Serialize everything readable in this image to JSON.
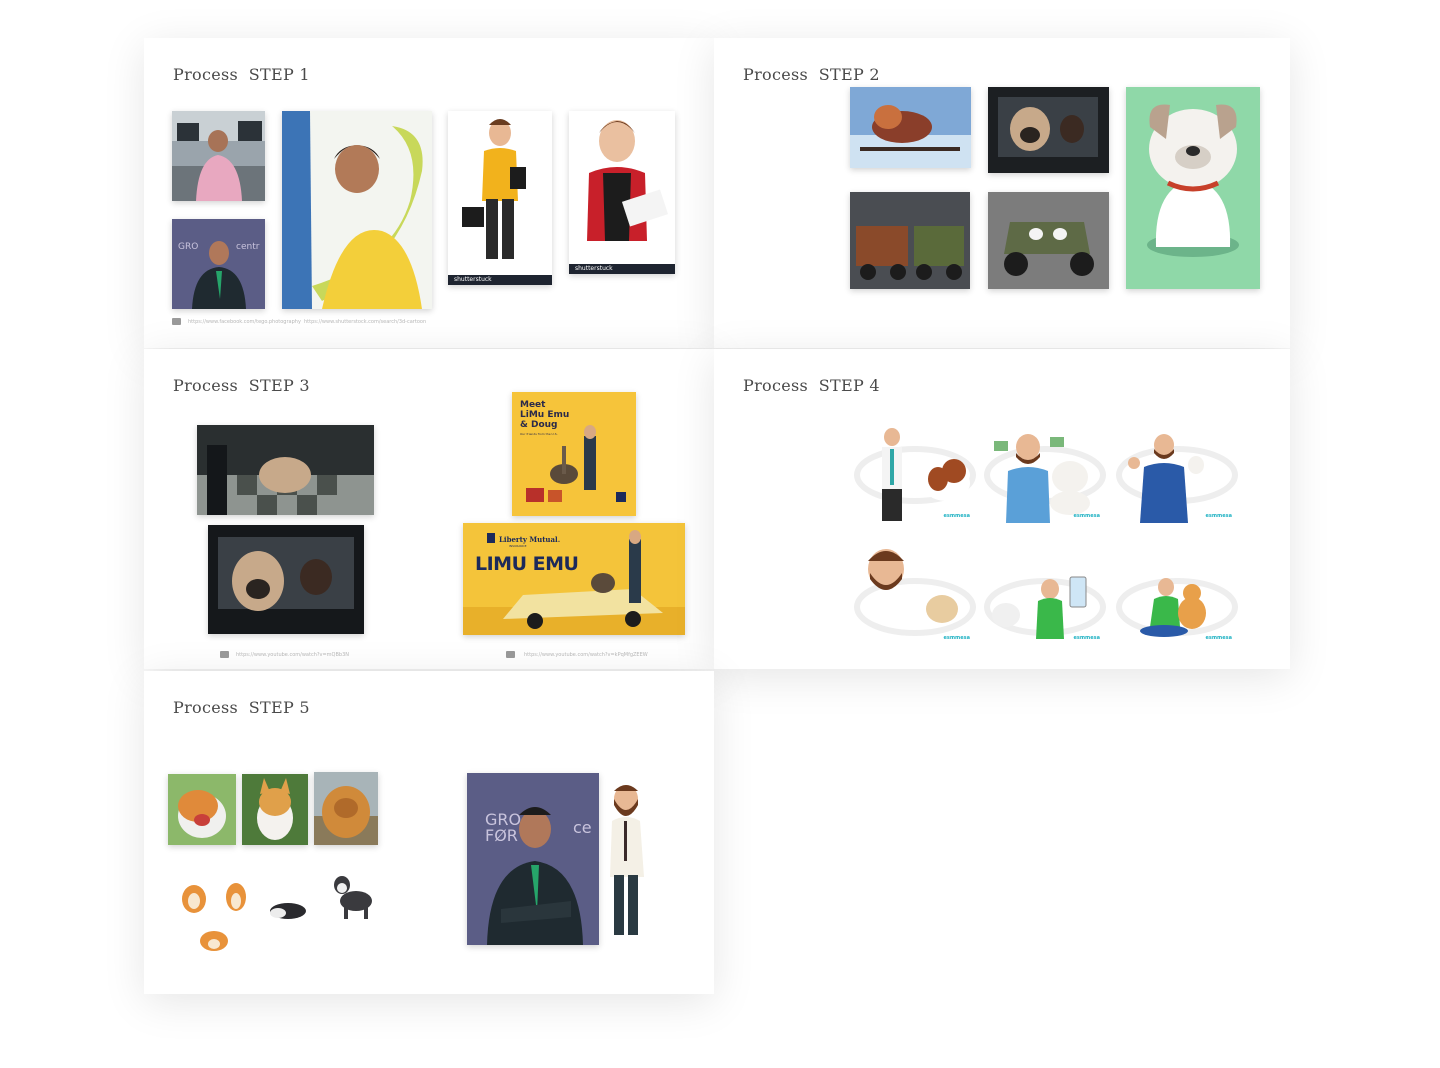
{
  "steps": [
    {
      "title": "Process  STEP 1"
    },
    {
      "title": "Process  STEP 2"
    },
    {
      "title": "Process  STEP 3"
    },
    {
      "title": "Process  STEP 4"
    },
    {
      "title": "Process  STEP 5"
    }
  ],
  "step1": {
    "stamp_1": "shutterstuck",
    "stamp_2": "shutterstuck",
    "source_1": "https://www.facebook.com/tego.photography",
    "source_2": "https://www.shutterstock.com/search/3d-cartoon"
  },
  "step3": {
    "poster1_line1": "Meet",
    "poster1_line2": "LiMu Emu",
    "poster1_line3": "& Doug",
    "poster1_small": "Our friends from the U.S.",
    "poster2_brand": "Liberty Mutual.",
    "poster2_sub": "INSURANCE",
    "poster2_title": "LIMU EMU",
    "source_1": "https://www.youtube.com/watch?v=mQBb3N",
    "source_2": "https://www.youtube.com/watch?v=kPqMfgZEEW"
  },
  "step4": {
    "brand": "esmmesa"
  },
  "colors": {
    "poster_yellow": "#f6c43a",
    "mint": "#8fd8a8",
    "card_shadow": "rgba(0,0,0,0.10)"
  }
}
